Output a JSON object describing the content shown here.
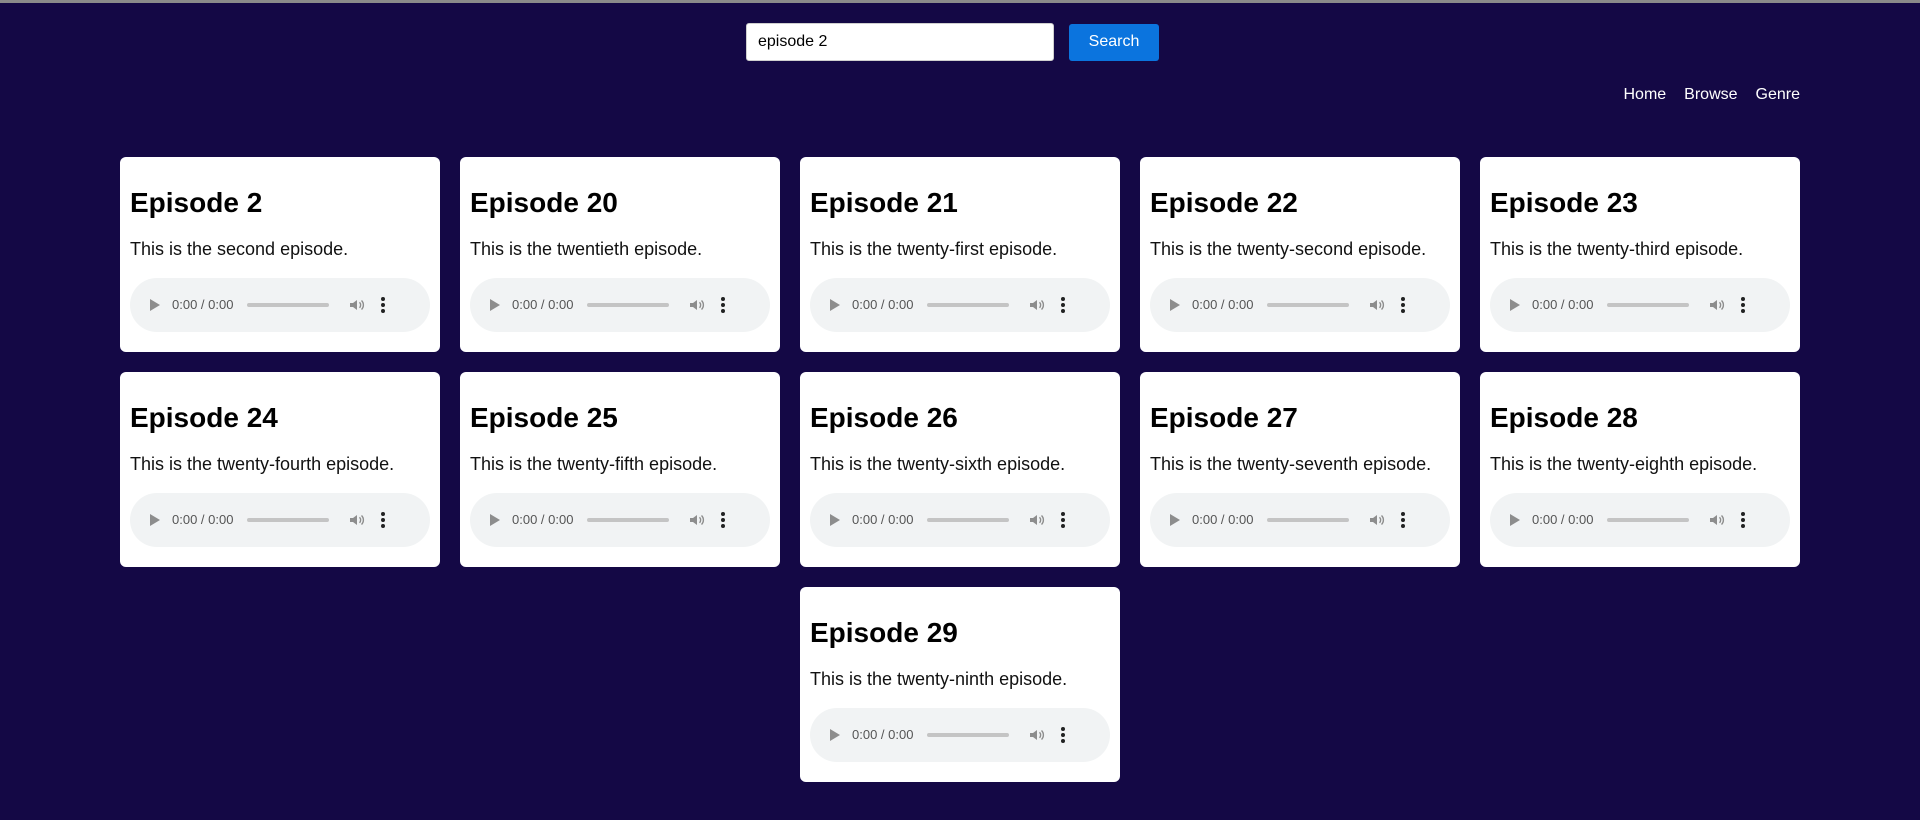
{
  "search": {
    "value": "episode 2",
    "button_label": "Search"
  },
  "nav": {
    "items": [
      "Home",
      "Browse",
      "Genre"
    ]
  },
  "episodes": [
    {
      "title": "Episode 2",
      "description": "This is the second episode.",
      "time": "0:00 / 0:00"
    },
    {
      "title": "Episode 20",
      "description": "This is the twentieth episode.",
      "time": "0:00 / 0:00"
    },
    {
      "title": "Episode 21",
      "description": "This is the twenty-first episode.",
      "time": "0:00 / 0:00"
    },
    {
      "title": "Episode 22",
      "description": "This is the twenty-second episode.",
      "time": "0:00 / 0:00"
    },
    {
      "title": "Episode 23",
      "description": "This is the twenty-third episode.",
      "time": "0:00 / 0:00"
    },
    {
      "title": "Episode 24",
      "description": "This is the twenty-fourth episode.",
      "time": "0:00 / 0:00"
    },
    {
      "title": "Episode 25",
      "description": "This is the twenty-fifth episode.",
      "time": "0:00 / 0:00"
    },
    {
      "title": "Episode 26",
      "description": "This is the twenty-sixth episode.",
      "time": "0:00 / 0:00"
    },
    {
      "title": "Episode 27",
      "description": "This is the twenty-seventh episode.",
      "time": "0:00 / 0:00"
    },
    {
      "title": "Episode 28",
      "description": "This is the twenty-eighth episode.",
      "time": "0:00 / 0:00"
    },
    {
      "title": "Episode 29",
      "description": "This is the twenty-ninth episode.",
      "time": "0:00 / 0:00"
    }
  ],
  "colors": {
    "background": "#140845",
    "accent": "#0b74de"
  },
  "icons": {
    "play": "play-icon",
    "volume": "volume-icon",
    "menu": "more-vertical-icon"
  }
}
